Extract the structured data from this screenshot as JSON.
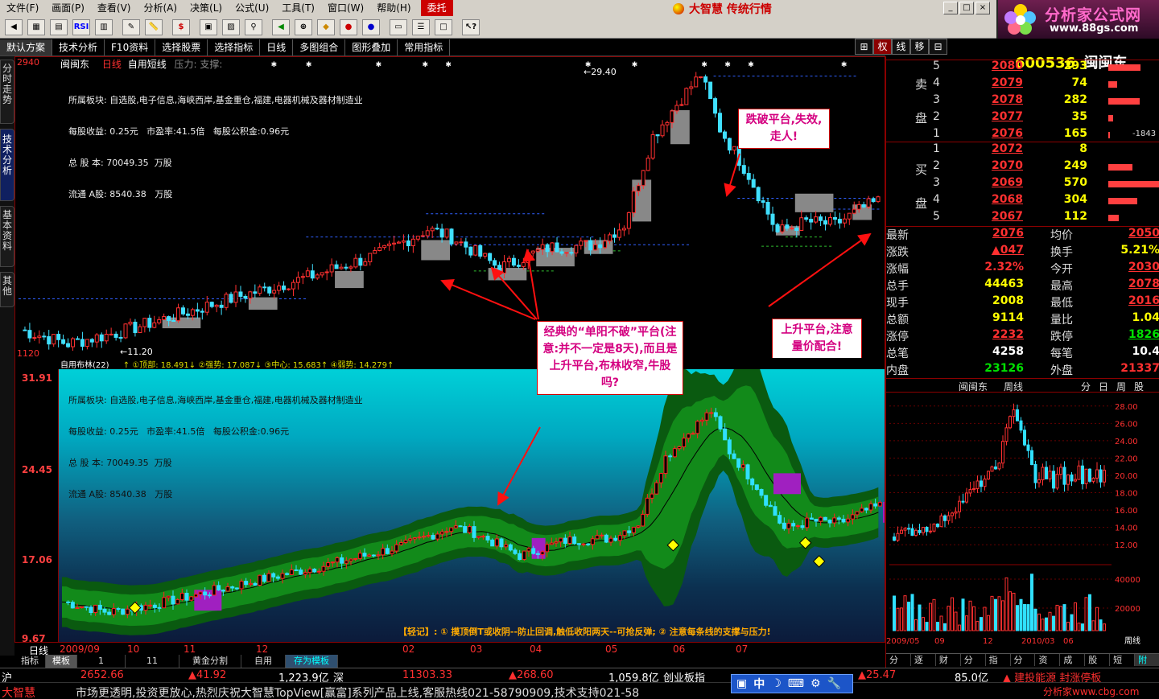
{
  "menu": {
    "items": [
      "文件(F)",
      "画面(P)",
      "查看(V)",
      "分析(A)",
      "决策(L)",
      "公式(U)",
      "工具(T)",
      "窗口(W)",
      "帮助(H)",
      "委托"
    ],
    "brand": "大智慧 传统行情",
    "win_controls": [
      "_",
      "□",
      "×"
    ]
  },
  "logo": {
    "title": "分析家公式网",
    "url": "www.88gs.com"
  },
  "toolbar2": {
    "items": [
      "默认方案",
      "技术分析",
      "F10资料",
      "选择股票",
      "选择指标",
      "日线",
      "多图组合",
      "图形叠加",
      "常用指标"
    ],
    "right_buttons": [
      "⊞",
      "权",
      "线",
      "移",
      "⊟"
    ]
  },
  "vtabs": [
    "分时走势",
    "技术分析",
    "基本资料",
    "其他"
  ],
  "upper": {
    "stock_name": "闽闽东",
    "period": "日线",
    "indicator": "自用短线",
    "indicator_extra": "压力: 支撑:",
    "price_top": "2940",
    "high_label": "29.40",
    "low_label": "11.20",
    "price_bottom": "1120",
    "info_lines": [
      "所属板块: 自选股,电子信息,海峡西岸,基金重仓,福建,电器机械及器材制造业",
      "每股收益: 0.25元   市盈率:41.5倍   每股公积金:0.96元",
      "总 股 本: 70049.35  万股",
      "流通 A股: 8540.38   万股"
    ]
  },
  "lower_head": {
    "name": "自用布林(22)",
    "text": "↑ ①顶部: 18.491↓ ②强势: 17.087↓ ③中心: 15.683↑ ④弱势: 14.279↑"
  },
  "lower": {
    "y_labels": [
      "31.91",
      "24.45",
      "17.06",
      "9.67"
    ],
    "info_lines": [
      "所属板块: 自选股,电子信息,海峡西岸,基金重仓,福建,电器机械及器材制造业",
      "每股收益: 0.25元   市盈率:41.5倍   每股公积金:0.96元",
      "总 股 本: 70049.35  万股",
      "流通 A股: 8540.38   万股"
    ],
    "mnemonic": "【轻记】: ① 摸顶倒T或收阴--防止回调,触低收阳两天--可抢反弹; ② 注意每条线的支撑与压力!"
  },
  "callouts": {
    "break": "跌破平台,失效,走人!",
    "classic": "经典的“单阳不破”平台(注意:并不一定是8天),而且是上升平台,布林收窄,牛股吗?",
    "rising": "上升平台,注意量价配合!"
  },
  "date_axis": {
    "period_label": "日线",
    "labels": [
      "2009/09",
      "10",
      "11",
      "12",
      "02",
      "03",
      "04",
      "05",
      "06",
      "07"
    ]
  },
  "bottom_tabs": [
    "指标",
    "模板",
    "1",
    "11",
    "黄金分割",
    "自用",
    "存为模板"
  ],
  "quote": {
    "code": "600536",
    "name": "闽闽东",
    "sell": [
      {
        "lvl": "5",
        "price": "2080",
        "vol": "293",
        "bar": 0.36
      },
      {
        "lvl": "4",
        "price": "2079",
        "vol": "74",
        "bar": 0.1
      },
      {
        "lvl": "3",
        "price": "2078",
        "vol": "282",
        "bar": 0.35
      },
      {
        "lvl": "2",
        "price": "2077",
        "vol": "35",
        "bar": 0.05
      },
      {
        "lvl": "1",
        "price": "2076",
        "vol": "165",
        "bar": 0.02,
        "extra": "-1843"
      }
    ],
    "buy": [
      {
        "lvl": "1",
        "price": "2072",
        "vol": "8",
        "bar": 0
      },
      {
        "lvl": "2",
        "price": "2070",
        "vol": "249",
        "bar": 0.27
      },
      {
        "lvl": "3",
        "price": "2069",
        "vol": "570",
        "bar": 0.62
      },
      {
        "lvl": "4",
        "price": "2068",
        "vol": "304",
        "bar": 0.33
      },
      {
        "lvl": "5",
        "price": "2067",
        "vol": "112",
        "bar": 0.12
      }
    ],
    "sell_label": [
      "卖",
      "盘"
    ],
    "buy_label": [
      "买",
      "盘"
    ],
    "stats": [
      {
        "k1": "最新",
        "v1": "2076",
        "c1": "red ul",
        "k2": "均价",
        "v2": "2050",
        "c2": "red ul"
      },
      {
        "k1": "涨跌",
        "v1": "▲047",
        "c1": "red ul",
        "k2": "换手",
        "v2": "5.21%",
        "c2": "yel"
      },
      {
        "k1": "涨幅",
        "v1": "2.32%",
        "c1": "red",
        "k2": "今开",
        "v2": "2030",
        "c2": "red ul"
      },
      {
        "k1": "总手",
        "v1": "44463",
        "c1": "yel",
        "k2": "最高",
        "v2": "2078",
        "c2": "red ul"
      },
      {
        "k1": "现手",
        "v1": "2008",
        "c1": "yel",
        "k2": "最低",
        "v2": "2016",
        "c2": "red ul"
      },
      {
        "k1": "总额",
        "v1": "9114",
        "c1": "yel",
        "k2": "量比",
        "v2": "1.04",
        "c2": "yel"
      },
      {
        "k1": "涨停",
        "v1": "2232",
        "c1": "red ul",
        "k2": "跌停",
        "v2": "1826",
        "c2": "grn ul"
      },
      {
        "k1": "总笔",
        "v1": "4258",
        "c1": "wht",
        "k2": "每笔",
        "v2": "10.4",
        "c2": "wht"
      },
      {
        "k1": "内盘",
        "v1": "23126",
        "c1": "grn",
        "k2": "外盘",
        "v2": "21337",
        "c2": "red"
      }
    ]
  },
  "mini": {
    "name": "闽闽东",
    "period": "周线",
    "tabs_right": [
      "分",
      "日",
      "周",
      "股"
    ],
    "y_labels": [
      "28.00",
      "26.00",
      "24.00",
      "22.00",
      "20.00",
      "18.00",
      "16.00",
      "14.00",
      "12.00"
    ],
    "vol_labels": [
      "40000",
      "20000"
    ],
    "x_labels": [
      "2009/05",
      "09",
      "12",
      "2010/03",
      "06"
    ],
    "x_right": "周线",
    "tabs": [
      "分笔",
      "逐笔",
      "财务",
      "分价",
      "指数",
      "分时",
      "资讯",
      "成本",
      "股评",
      "短线",
      "附图"
    ]
  },
  "status1": {
    "sh_label": "沪",
    "sh_index": "2652.66",
    "sh_change": "▲41.92",
    "sh_amount": "1,223.9亿",
    "sz_label": "深",
    "sz_index": "11303.33",
    "sz_change": "▲268.60",
    "sz_amount": "1,059.8亿",
    "cy_label": "创业板指",
    "cy_change": "▲25.47",
    "cy_amount": "85.0亿",
    "ticker": "▲ 建投能源 封涨停板"
  },
  "status2": {
    "brand": "大智慧",
    "marquee": "市场更透明,投资更放心,热烈庆祝大智慧TopView[赢富]系列产品上线,客服热线021-58790909,技术支持021-58",
    "watermark": "分析家www.cbg.com"
  },
  "ime": [
    "中",
    "☽",
    "⌨",
    "⚙",
    "🔧"
  ]
}
